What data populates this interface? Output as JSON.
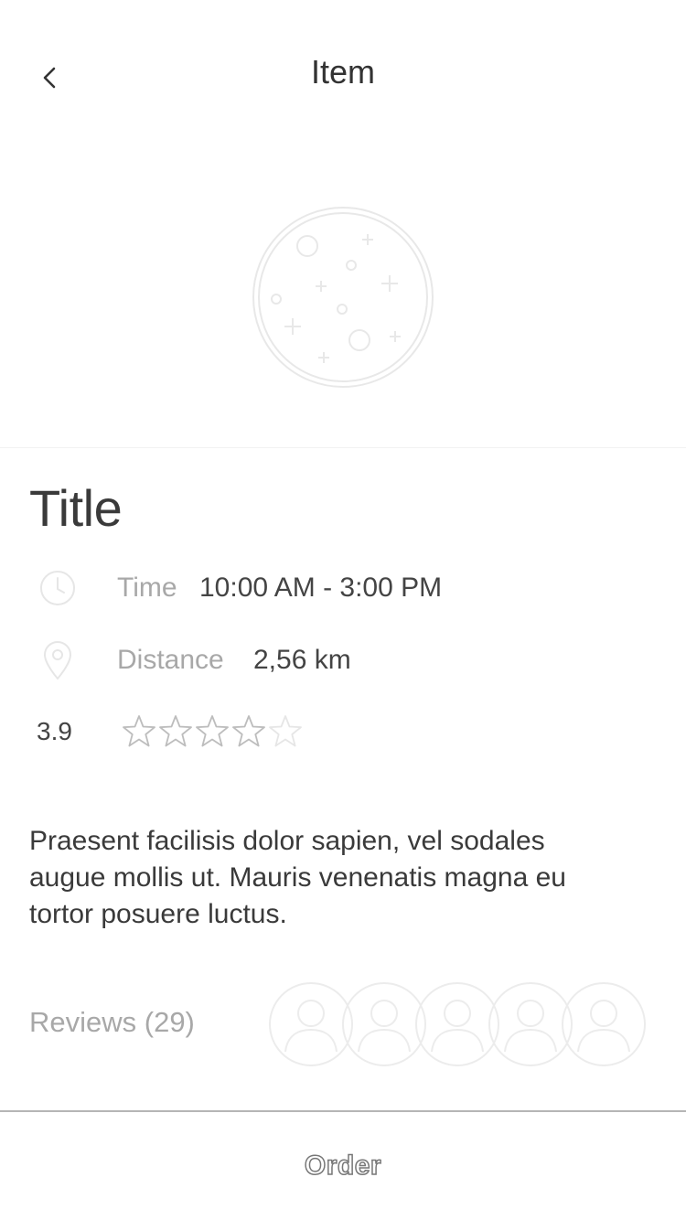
{
  "nav": {
    "title": "Item",
    "back_icon": "chevron-left-icon"
  },
  "hero": {
    "icon": "pizza-icon"
  },
  "item": {
    "title": "Title",
    "time": {
      "label": "Time",
      "value": "10:00 AM - 3:00 PM",
      "icon": "clock-icon"
    },
    "distance": {
      "label": "Distance",
      "value": "2,56 km",
      "icon": "location-pin-icon"
    },
    "rating": {
      "value": "3.9",
      "stars_filled": 4,
      "stars_total": 5
    },
    "description": "Praesent facilisis dolor sapien, vel sodales augue mollis ut. Mauris venenatis magna eu tortor posuere luctus."
  },
  "reviews": {
    "label": "Reviews (29)",
    "avatar_count": 5
  },
  "footer": {
    "order_label": "Order"
  },
  "colors": {
    "text": "#333333",
    "muted": "#a8a8a8",
    "line": "#b5b5b5",
    "placeholder": "#e6e6e6"
  }
}
